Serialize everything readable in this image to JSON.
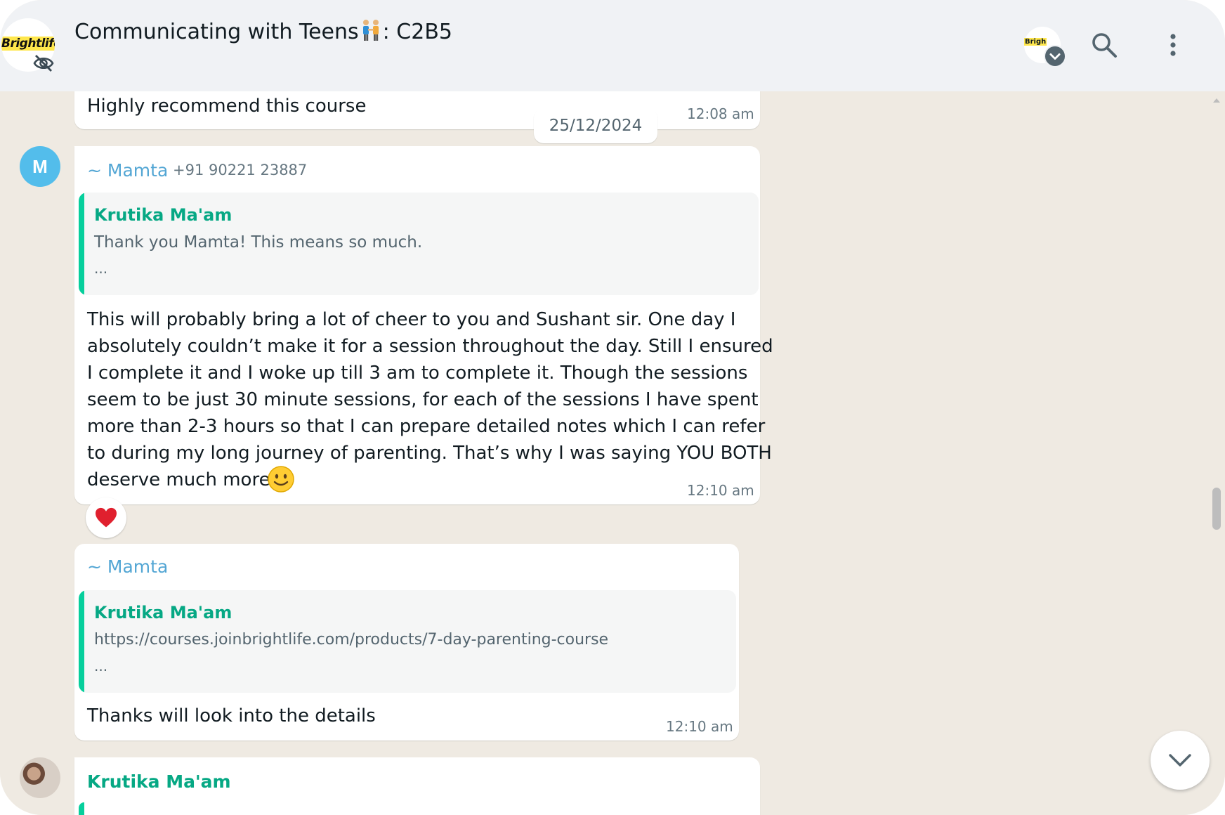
{
  "header": {
    "group_logo_text": "Brightlife",
    "title": "Communicating with Teens",
    "title_emoji": "people-holding-hands",
    "title_suffix": ": C2B5",
    "mini_avatar_text": "Brigh",
    "icons": [
      "eye-off-icon",
      "chevron-down-icon",
      "search-icon",
      "more-vertical-icon"
    ]
  },
  "date_divider": "25/12/2024",
  "messages": [
    {
      "text": "Highly recommend this course",
      "time": "12:08 am"
    },
    {
      "avatar_letter": "M",
      "sender": "~ Mamta",
      "phone": "+91 90221 23887",
      "quote_author": "Krutika Ma'am",
      "quote_text": "Thank you Mamta! This means so much.",
      "quote_more": "...",
      "lines": [
        "This will probably bring a lot of cheer to you and Sushant sir. One day I",
        "absolutely couldn’t make it for a session throughout the day. Still I ensured",
        "I complete it and I woke up till 3 am to complete it. Though the sessions",
        "seem to be just 30 minute sessions, for each of the sessions I have spent",
        "more than 2-3 hours so that I can prepare detailed notes which I can refer",
        "to during my long journey of parenting. That’s why I was saying YOU BOTH",
        "deserve much more"
      ],
      "emoji": "slightly-smiling-face",
      "time": "12:10 am",
      "reaction": "red-heart"
    },
    {
      "sender": "~ Mamta",
      "quote_author": "Krutika Ma'am",
      "quote_text": "https://courses.joinbrightlife.com/products/7-day-parenting-course",
      "quote_more": "...",
      "text": "Thanks will look into the details",
      "time": "12:10 am"
    },
    {
      "sender": "Krutika Ma'am"
    }
  ],
  "colors": {
    "chat_background": "#efeae2",
    "header_background": "#f0f2f5",
    "bubble": "#ffffff",
    "quote_bar": "#06cf9c",
    "quote_author": "#06a884",
    "sender_name": "#53a6d4",
    "avatar_m": "#53bdeb",
    "timestamp": "#667781"
  }
}
